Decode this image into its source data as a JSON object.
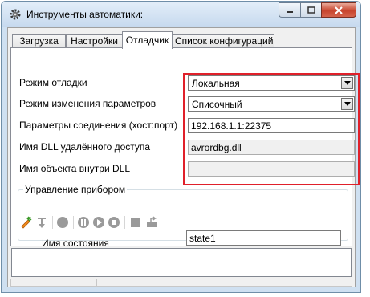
{
  "window": {
    "title": "Инструменты автоматики:"
  },
  "tabs": [
    {
      "label": "Загрузка"
    },
    {
      "label": "Настройки"
    },
    {
      "label": "Отладчик"
    },
    {
      "label": "Список конфигураций"
    }
  ],
  "active_tab": "Отладчик",
  "debugger": {
    "mode_label": "Режим отладки",
    "mode_value": "Локальная",
    "param_mode_label": "Режим изменения параметров",
    "param_mode_value": "Списочный",
    "conn_label": "Параметры соединения (хост:порт)",
    "conn_value": "192.168.1.1:22375",
    "dll_label": "Имя DLL удалённого доступа",
    "dll_value": "avrordbg.dll",
    "obj_label": "Имя объекта внутри DLL",
    "obj_value": ""
  },
  "device_control": {
    "title": "Управление прибором",
    "state_label": "Имя состояния",
    "state_value": "state1"
  },
  "colors": {
    "highlight": "#e0202a",
    "close_button": "#c7442d"
  }
}
